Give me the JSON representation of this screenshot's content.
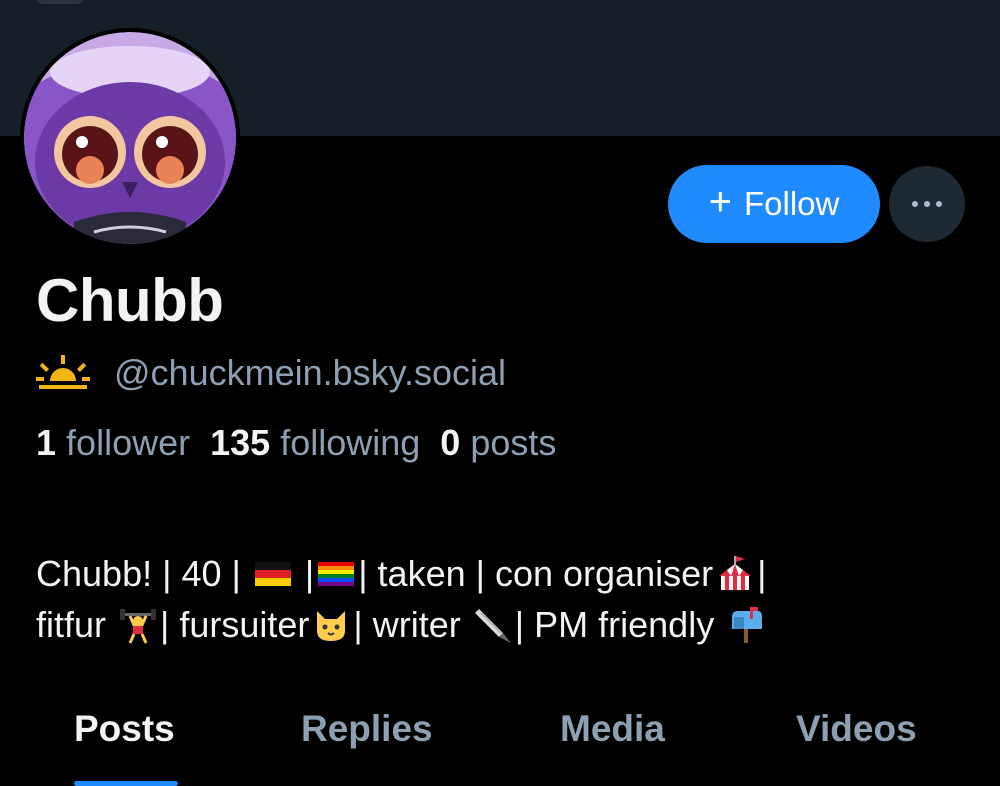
{
  "profile": {
    "display_name": "Chubb",
    "handle": "@chuckmein.bsky.social",
    "status_icon": "sunrise-icon",
    "avatar_icon": "owl-character-avatar"
  },
  "actions": {
    "follow_plus": "+",
    "follow_label": "Follow",
    "more_icon": "ellipsis-icon"
  },
  "stats": {
    "followers_count": "1",
    "followers_label": "follower",
    "following_count": "135",
    "following_label": "following",
    "posts_count": "0",
    "posts_label": "posts"
  },
  "bio": {
    "l1_a": "Chubb! | 40 | ",
    "l1_b": " |",
    "l1_c": "| taken | con organiser",
    "l1_d": "|",
    "l2_a": "fitfur ",
    "l2_b": "| fursuiter",
    "l2_c": "| writer ",
    "l2_d": "| PM friendly ",
    "emoji": [
      "german-flag-icon",
      "rainbow-flag-icon",
      "circus-tent-icon",
      "weightlifter-icon",
      "cat-face-icon",
      "fountain-pen-icon",
      "mailbox-icon"
    ]
  },
  "tabs": {
    "posts": "Posts",
    "replies": "Replies",
    "media": "Media",
    "videos": "Videos",
    "active": "Posts"
  },
  "colors": {
    "background": "#000000",
    "banner": "#161e27",
    "accent": "#208bfe",
    "muted_text": "#8d9fb3",
    "primary_text": "#f1f3f5"
  }
}
